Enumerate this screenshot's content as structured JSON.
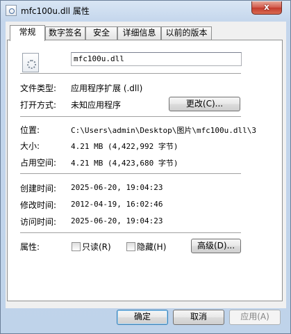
{
  "window": {
    "title": "mfc100u.dll 属性",
    "close_label": "x"
  },
  "tabs": [
    "常规",
    "数字签名",
    "安全",
    "详细信息",
    "以前的版本"
  ],
  "general": {
    "file_name": "mfc100u.dll",
    "file_type_label": "文件类型:",
    "file_type_value": "应用程序扩展 (.dll)",
    "open_with_label": "打开方式:",
    "open_with_value": "未知应用程序",
    "change_button": "更改(C)...",
    "location_label": "位置:",
    "location_value": "C:\\Users\\admin\\Desktop\\图片\\mfc100u.dll\\3",
    "size_label": "大小:",
    "size_value": "4.21 MB (4,422,992 字节)",
    "size_on_disk_label": "占用空间:",
    "size_on_disk_value": "4.21 MB (4,423,680 字节)",
    "created_label": "创建时间:",
    "created_value": "2025-06-20, 19:04:23",
    "modified_label": "修改时间:",
    "modified_value": "2012-04-19, 16:02:46",
    "accessed_label": "访问时间:",
    "accessed_value": "2025-06-20, 19:04:23",
    "attributes_label": "属性:",
    "readonly_label": "只读(R)",
    "hidden_label": "隐藏(H)",
    "advanced_button": "高级(D)..."
  },
  "footer": {
    "ok": "确定",
    "cancel": "取消",
    "apply": "应用(A)"
  }
}
